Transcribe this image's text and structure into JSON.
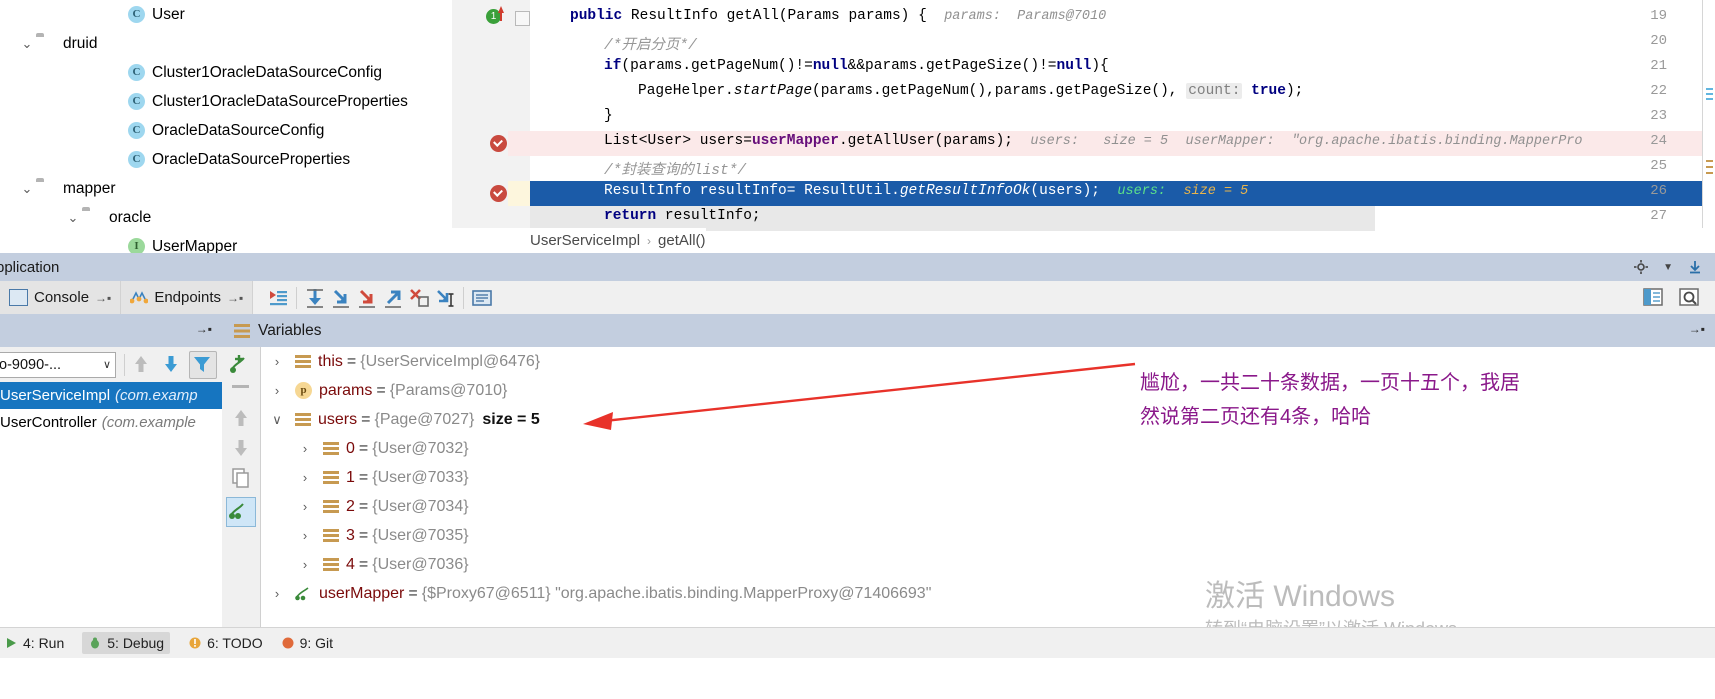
{
  "project_tree": {
    "items": [
      {
        "indent": 3,
        "icon": "class-icon",
        "chevron": false,
        "label": "User"
      },
      {
        "indent": 1,
        "icon": "folder-icon",
        "chevron": true,
        "label": "druid"
      },
      {
        "indent": 3,
        "icon": "class-icon",
        "chevron": false,
        "label": "Cluster1OracleDataSourceConfig"
      },
      {
        "indent": 3,
        "icon": "class-icon",
        "chevron": false,
        "label": "Cluster1OracleDataSourceProperties"
      },
      {
        "indent": 3,
        "icon": "class-icon",
        "chevron": false,
        "label": "OracleDataSourceConfig"
      },
      {
        "indent": 3,
        "icon": "class-icon",
        "chevron": false,
        "label": "OracleDataSourceProperties"
      },
      {
        "indent": 1,
        "icon": "folder-icon",
        "chevron": true,
        "label": "mapper"
      },
      {
        "indent": 2,
        "icon": "folder-icon",
        "chevron": true,
        "label": "oracle"
      },
      {
        "indent": 3,
        "icon": "interface-icon",
        "chevron": false,
        "label": "UserMapper"
      }
    ],
    "class_glyph": "C",
    "interface_glyph": "I"
  },
  "editor": {
    "lines": [
      {
        "n": "19",
        "marker": "run-to-cursor-icon",
        "fold": true,
        "highlight": "none"
      },
      {
        "n": "20",
        "highlight": "none"
      },
      {
        "n": "21",
        "highlight": "none"
      },
      {
        "n": "22",
        "highlight": "none"
      },
      {
        "n": "23",
        "highlight": "none"
      },
      {
        "n": "24",
        "marker": "breakpoint-icon",
        "highlight": "pink"
      },
      {
        "n": "25",
        "highlight": "none"
      },
      {
        "n": "26",
        "marker": "breakpoint-icon",
        "highlight": "blue"
      },
      {
        "n": "27",
        "highlight": "grey"
      }
    ],
    "code": {
      "l19_kw": "public",
      "l19_rest": " ResultInfo getAll(Params params) {",
      "l19_hint": "params:  Params@7010",
      "l20": "/*开启分页*/",
      "l21_if": "if",
      "l21_a": "(params.getPageNum()!=",
      "l21_null1": "null",
      "l21_b": "&&params.getPageSize()!=",
      "l21_null2": "null",
      "l21_c": "){",
      "l22_a": "PageHelper.",
      "l22_m": "startPage",
      "l22_b": "(params.getPageNum(),params.getPageSize(), ",
      "l22_chip": "count:",
      "l22_true": "true",
      "l22_c": ");",
      "l23": "}",
      "l24_a": "List<User> users=",
      "l24_f": "userMapper",
      "l24_b": ".getAllUser(params);",
      "l24_hint1": "users:   size = 5",
      "l24_hint2": "userMapper:  ʺorg.apache.ibatis.binding.MapperPro",
      "l25": "/*封装查询的list*/",
      "l26_a": "ResultInfo resultInfo= ResultUtil.",
      "l26_m": "getResultInfoOk",
      "l26_b": "(users);",
      "l26_hint_name": "users:",
      "l26_hint_val": "size = 5",
      "l27_kw": "return",
      "l27_rest": " resultInfo;"
    },
    "breadcrumb": {
      "class": "UserServiceImpl",
      "separator": "›",
      "method": "getAll()"
    }
  },
  "debug_window": {
    "title": "pplication",
    "settings_icon": "gear-icon",
    "hide_icon": "hide-down-icon",
    "tabs": [
      {
        "label": "Console",
        "icon": "console-icon",
        "pin": "→▪"
      },
      {
        "label": "Endpoints",
        "icon": "endpoints-icon",
        "pin": "→▪"
      }
    ],
    "toolbar_buttons": [
      "show-execution-point-icon",
      "step-over-icon",
      "step-into-icon",
      "force-step-into-icon",
      "step-out-icon",
      "drop-frame-icon",
      "run-to-cursor-icon",
      "evaluate-expression-icon"
    ],
    "right_buttons": [
      "layout-settings-icon",
      "inspect-icon"
    ]
  },
  "frames_pane": {
    "pin_icon": "→▪",
    "thread_selector": "o-9090-...",
    "thread_chevron": "∨",
    "buttons": [
      "frame-up-icon",
      "frame-down-icon",
      "filter-icon"
    ],
    "frames": [
      {
        "name": "UserServiceImpl",
        "package": "(com.examp",
        "selected": true
      },
      {
        "name": "UserController",
        "package": "(com.example",
        "selected": false
      }
    ]
  },
  "variables_pane": {
    "title": "Variables",
    "title_icon": "variables-icon",
    "pin_icon": "→▪",
    "sidebar_buttons": [
      "add-watch-icon",
      "remove-watch-icon",
      "move-up-icon",
      "move-down-icon",
      "copy-icon",
      "inline-watch-icon"
    ],
    "rows": [
      {
        "indent": 0,
        "arrow": "›",
        "expanded": false,
        "icon": "object-icon",
        "name": "this",
        "eq": "=",
        "value": "{UserServiceImpl@6476}",
        "size": ""
      },
      {
        "indent": 0,
        "arrow": "›",
        "expanded": false,
        "icon": "param-icon",
        "name": "params",
        "eq": "=",
        "value": "{Params@7010}",
        "size": ""
      },
      {
        "indent": 0,
        "arrow": "∨",
        "expanded": true,
        "icon": "object-icon",
        "name": "users",
        "eq": "=",
        "value": "{Page@7027}",
        "size": "size = 5"
      },
      {
        "indent": 1,
        "arrow": "›",
        "expanded": false,
        "icon": "object-icon",
        "name": "0",
        "eq": "=",
        "value": "{User@7032}",
        "size": ""
      },
      {
        "indent": 1,
        "arrow": "›",
        "expanded": false,
        "icon": "object-icon",
        "name": "1",
        "eq": "=",
        "value": "{User@7033}",
        "size": ""
      },
      {
        "indent": 1,
        "arrow": "›",
        "expanded": false,
        "icon": "object-icon",
        "name": "2",
        "eq": "=",
        "value": "{User@7034}",
        "size": ""
      },
      {
        "indent": 1,
        "arrow": "›",
        "expanded": false,
        "icon": "object-icon",
        "name": "3",
        "eq": "=",
        "value": "{User@7035}",
        "size": ""
      },
      {
        "indent": 1,
        "arrow": "›",
        "expanded": false,
        "icon": "object-icon",
        "name": "4",
        "eq": "=",
        "value": "{User@7036}",
        "size": ""
      },
      {
        "indent": 0,
        "arrow": "›",
        "expanded": false,
        "icon": "watch-icon",
        "name": "userMapper",
        "eq": "=",
        "value": "{$Proxy67@6511} \"org.apache.ibatis.binding.MapperProxy@71406693\"",
        "size": ""
      }
    ]
  },
  "annotation": {
    "line1": "尴尬，一共二十条数据，一页十五个，我居",
    "line2": "然说第二页还有4条，哈哈",
    "color": "#8a188a",
    "arrow_color": "#e8322a"
  },
  "watermark": {
    "line1": "激活 Windows",
    "line2": "转到“电脑设置”以激活 Windows。"
  },
  "status_bar": {
    "items": [
      {
        "label": "4: Run",
        "icon": "run-icon"
      },
      {
        "label": "5: Debug",
        "icon": "debug-icon",
        "selected": true
      },
      {
        "label": "6: TODO",
        "icon": "todo-icon"
      },
      {
        "label": "9: Git",
        "icon": "git-icon"
      }
    ]
  },
  "colors": {
    "panel_header": "#c3cedf",
    "selection_blue": "#1b5ba8",
    "frame_selected": "#1675c0",
    "breakpoint_red": "#c94a3f",
    "pink_row": "#fbe9e9",
    "annotation_purple": "#8a188a",
    "arrow_red": "#e8322a"
  }
}
